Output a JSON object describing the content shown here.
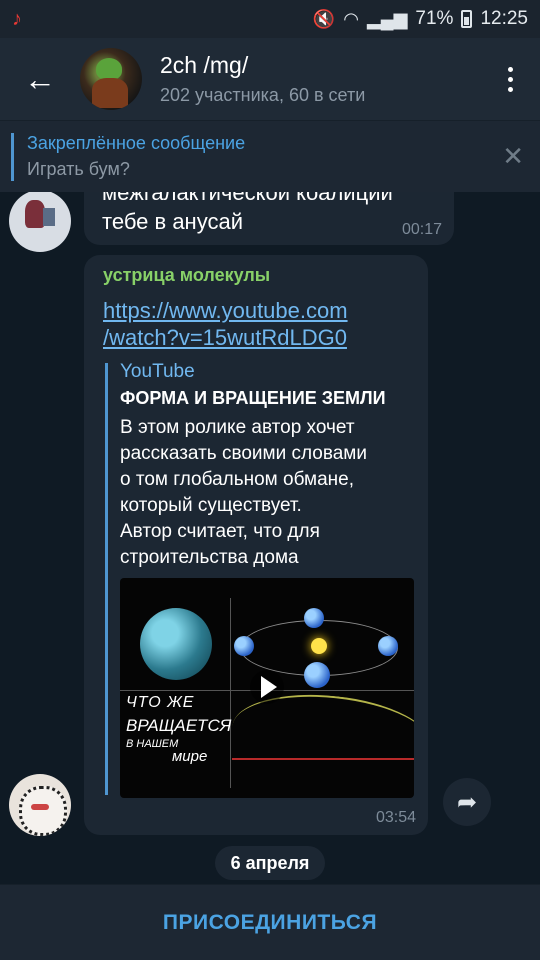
{
  "status_bar": {
    "battery": "71%",
    "time": "12:25",
    "icons": [
      "music-note-icon",
      "mute-icon",
      "wifi-icon",
      "signal-icon",
      "battery-icon"
    ]
  },
  "header": {
    "title": "2ch /mg/",
    "subtitle": "202 участника, 60 в сети",
    "back_icon": "←",
    "menu_icon": "more-vertical-icon"
  },
  "pinned": {
    "title": "Закреплённое сообщение",
    "text": "Играть бум?",
    "close_icon": "✕"
  },
  "messages": [
    {
      "lines": [
        "межгалактической коалиции",
        "тебе в анусай"
      ],
      "time": "00:17"
    },
    {
      "sender": "устрица молекулы",
      "link_lines": [
        "https://www.youtube.com",
        "/watch?v=15wutRdLDG0"
      ],
      "preview": {
        "site": "YouTube",
        "title": "ФОРМА И ВРАЩЕНИЕ ЗЕМЛИ",
        "description_lines": [
          "В этом ролике автор хочет",
          "рассказать своими словами",
          "о том глобальном обмане,",
          "который существует.",
          "Автор считает, что для",
          "строительства дома"
        ],
        "thumbnail_text": [
          "ЧТО  ЖЕ",
          "ВРАЩАЕТСЯ",
          "В НАШЕМ",
          "мире"
        ]
      },
      "time": "03:54"
    }
  ],
  "date_separator": "6 апреля",
  "share_icon": "➦",
  "join_button": "ПРИСОЕДИНИТЬСЯ"
}
